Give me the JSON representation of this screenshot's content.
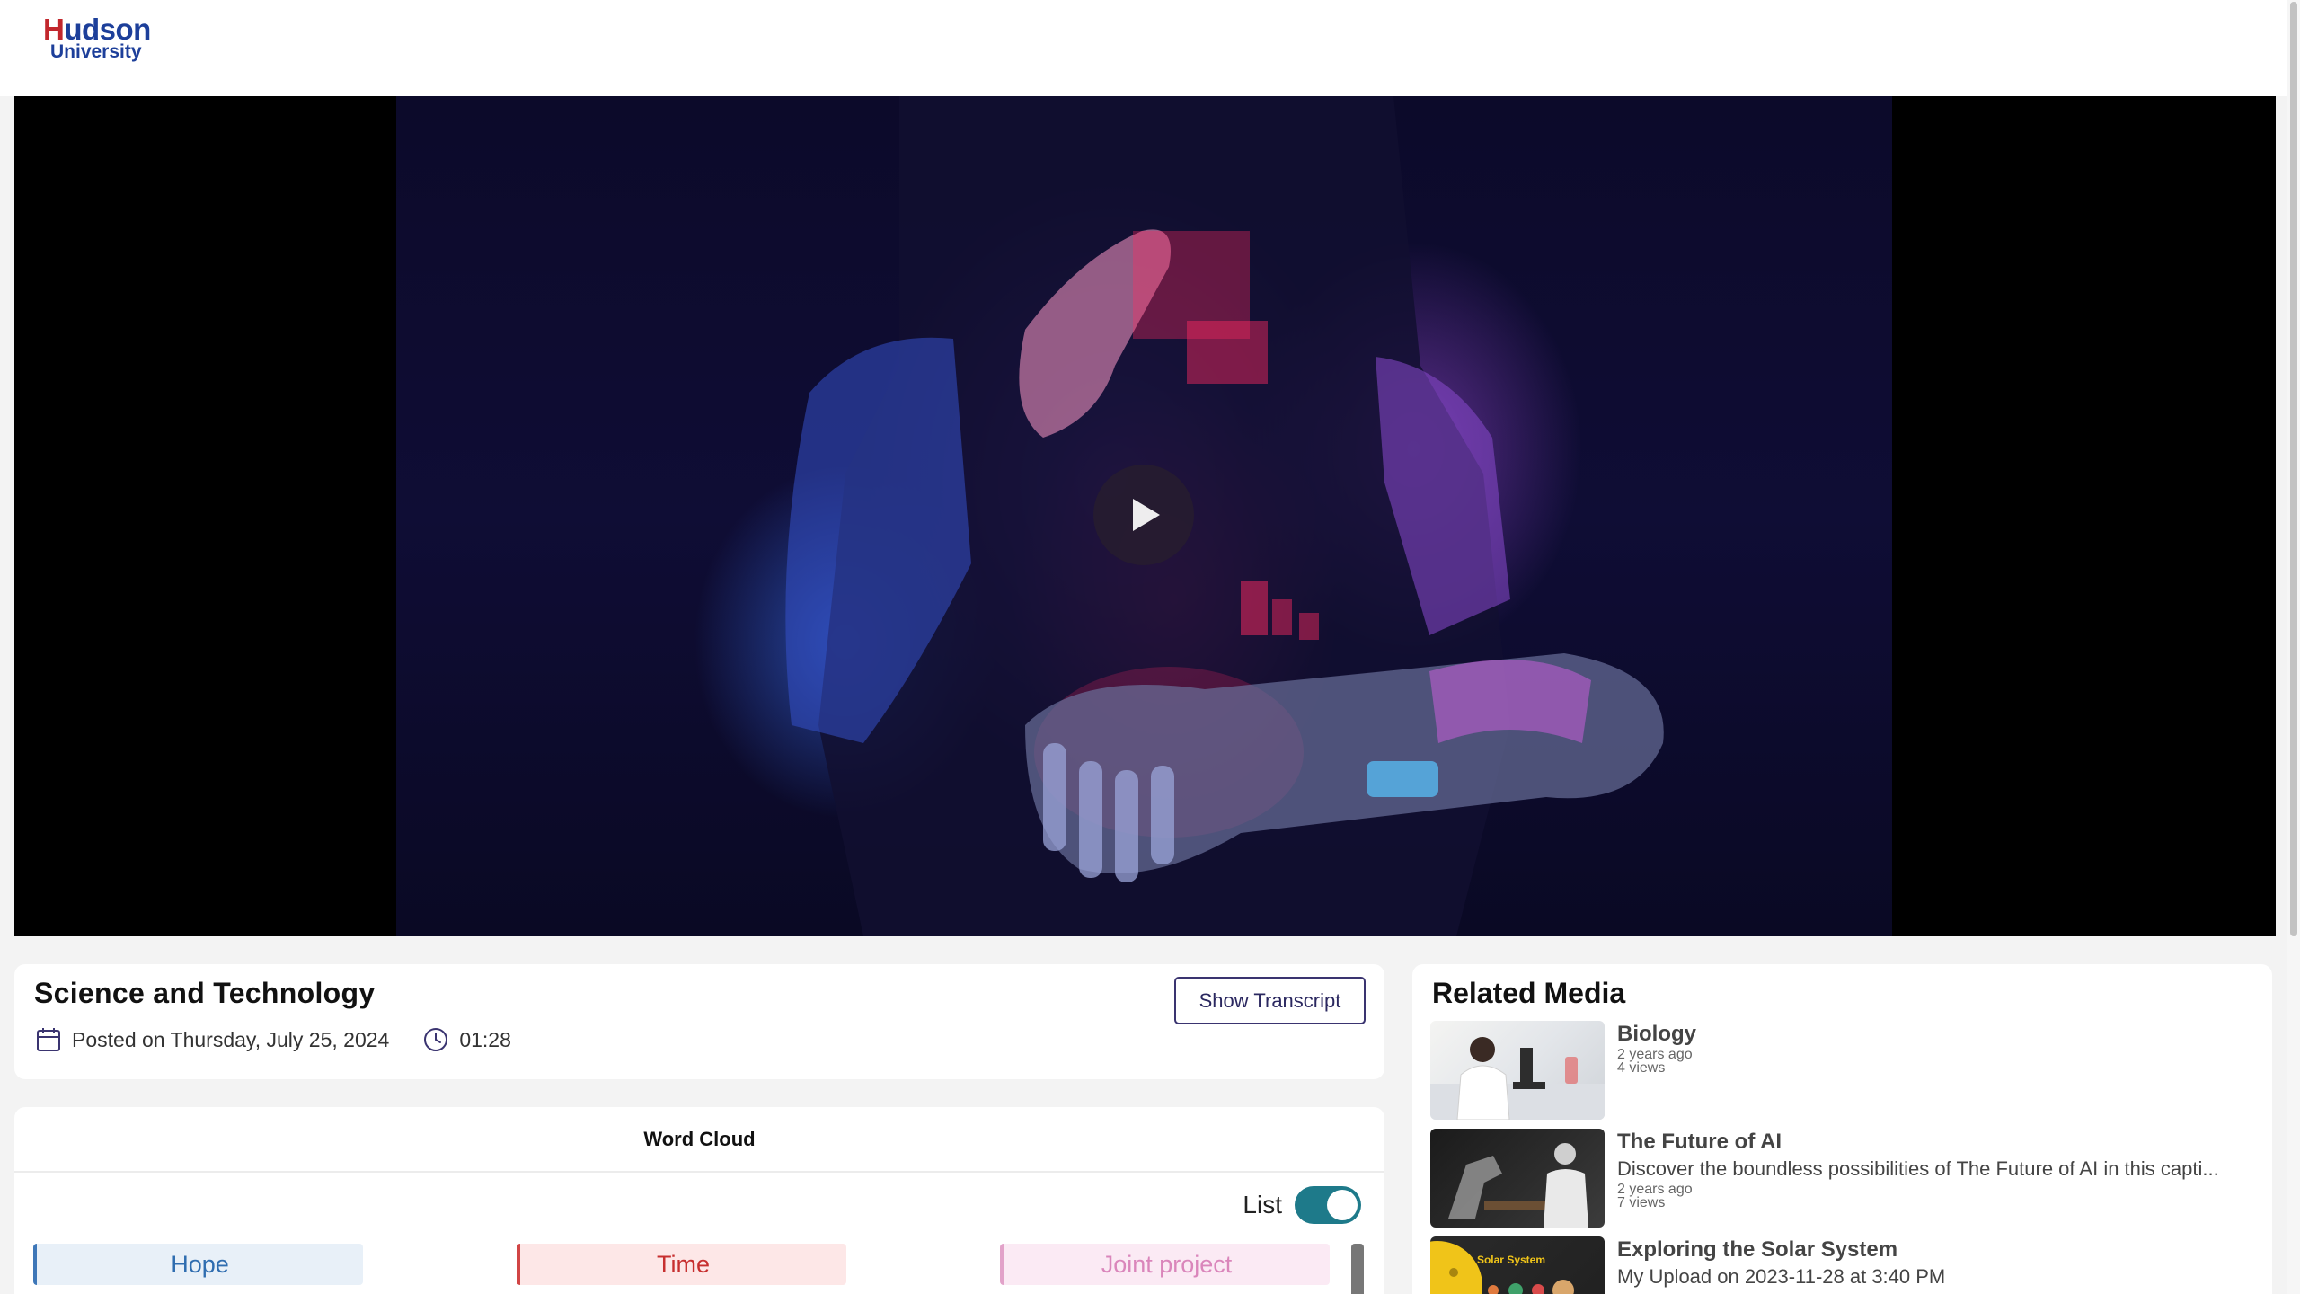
{
  "header": {
    "logo_top": "Hudson",
    "logo_bottom": "University"
  },
  "player": {
    "play_label": "Play video"
  },
  "video": {
    "title": "Science and Technology",
    "posted": "Posted on Thursday, July 25, 2024",
    "duration": "01:28",
    "transcript_button": "Show Transcript"
  },
  "word_cloud": {
    "title": "Word Cloud",
    "list_label": "List",
    "list_enabled": true,
    "chips": [
      "Hope",
      "Time",
      "Joint project"
    ]
  },
  "related": {
    "title": "Related Media",
    "items": [
      {
        "name": "Biology",
        "description": "",
        "age": "2 years ago",
        "views": "4 views"
      },
      {
        "name": "The Future of AI",
        "description": "Discover the boundless possibilities of The Future of AI in this capti...",
        "age": "2 years ago",
        "views": "7 views"
      },
      {
        "name": "Exploring the Solar System",
        "description": "My Upload on 2023-11-28 at 3:40 PM",
        "thumb_text": "Solar System",
        "age": "",
        "views": ""
      }
    ]
  },
  "colors": {
    "brand_blue": "#1d3f9a",
    "brand_red": "#c2272d",
    "toggle_on": "#1e7a8a",
    "button_border": "#3a3470"
  }
}
